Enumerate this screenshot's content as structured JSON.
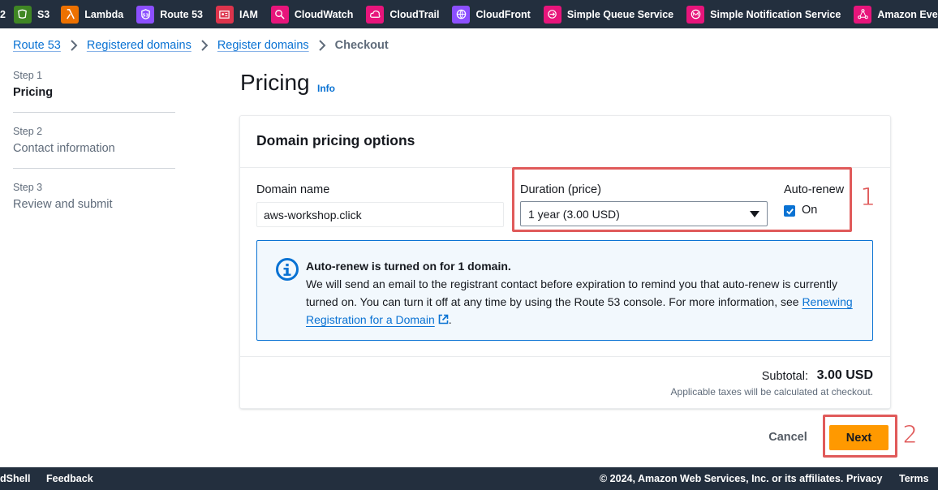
{
  "services_bar": {
    "partial_left": "2",
    "items": [
      {
        "label": "S3",
        "icon": "s3-icon",
        "color": "#3f8624"
      },
      {
        "label": "Lambda",
        "icon": "lambda-icon",
        "color": "#ed7100"
      },
      {
        "label": "Route 53",
        "icon": "route53-icon",
        "color": "#8c4fff"
      },
      {
        "label": "IAM",
        "icon": "iam-icon",
        "color": "#dd344c"
      },
      {
        "label": "CloudWatch",
        "icon": "cloudwatch-icon",
        "color": "#e7157b"
      },
      {
        "label": "CloudTrail",
        "icon": "cloudtrail-icon",
        "color": "#e7157b"
      },
      {
        "label": "CloudFront",
        "icon": "cloudfront-icon",
        "color": "#8c4fff"
      },
      {
        "label": "Simple Queue Service",
        "icon": "sqs-icon",
        "color": "#e7157b"
      },
      {
        "label": "Simple Notification Service",
        "icon": "sns-icon",
        "color": "#e7157b"
      },
      {
        "label": "Amazon EventBridge",
        "icon": "eventbridge-icon",
        "color": "#e7157b"
      }
    ]
  },
  "breadcrumb": {
    "items": [
      "Route 53",
      "Registered domains",
      "Register domains"
    ],
    "current": "Checkout"
  },
  "steps": [
    {
      "num": "Step 1",
      "label": "Pricing",
      "active": true
    },
    {
      "num": "Step 2",
      "label": "Contact information",
      "active": false
    },
    {
      "num": "Step 3",
      "label": "Review and submit",
      "active": false
    }
  ],
  "page": {
    "title": "Pricing",
    "info": "Info"
  },
  "pricing": {
    "header": "Domain pricing options",
    "domain_label": "Domain name",
    "domain_value": "aws-workshop.click",
    "duration_label": "Duration (price)",
    "duration_value": "1 year (3.00 USD)",
    "autorenew_label": "Auto-renew",
    "autorenew_option": "On",
    "autorenew_checked": true
  },
  "alert": {
    "title": "Auto-renew is turned on for 1 domain.",
    "body": "We will send an email to the registrant contact before expiration to remind you that auto-renew is currently turned on. You can turn it off at any time by using the Route 53 console. For more information, see ",
    "link": "Renewing Registration for a Domain",
    "tail": "."
  },
  "summary": {
    "subtotal_label": "Subtotal:",
    "subtotal_value": "3.00 USD",
    "tax_note": "Applicable taxes will be calculated at checkout."
  },
  "actions": {
    "cancel": "Cancel",
    "next": "Next"
  },
  "annotations": {
    "one": "1",
    "two": "2"
  },
  "bottom_bar": {
    "cloudshell": "dShell",
    "feedback": "Feedback",
    "copyright": "© 2024, Amazon Web Services, Inc. or its affiliates.",
    "privacy": "Privacy",
    "terms": "Terms"
  }
}
